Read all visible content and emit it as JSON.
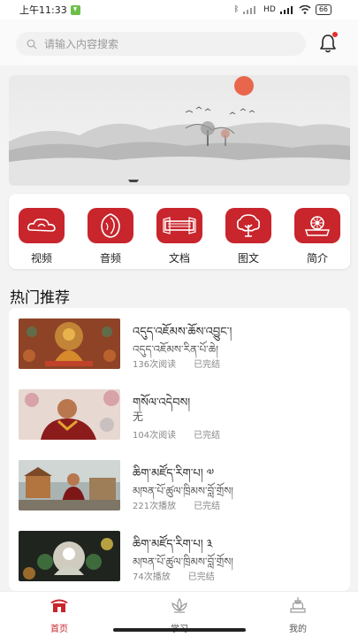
{
  "status_bar": {
    "time": "上午11:33",
    "network": "HD",
    "battery": "66"
  },
  "search": {
    "placeholder": "请输入内容搜索"
  },
  "banner": {
    "slide_index": 3,
    "slide_count": 5
  },
  "categories": [
    {
      "label": "视频",
      "icon": "cloud-icon"
    },
    {
      "label": "音频",
      "icon": "conch-shell-icon"
    },
    {
      "label": "文档",
      "icon": "scripture-icon"
    },
    {
      "label": "图文",
      "icon": "tree-icon"
    },
    {
      "label": "简介",
      "icon": "dharma-wheel-icon"
    }
  ],
  "section": {
    "title": "热门推荐"
  },
  "items": [
    {
      "title": "འདུད་འཇོམས་ཆོས་འབྱུང་།",
      "subtitle": "འདུད་འཇོམས་རིན་པོ་ཆེ།",
      "count": "136次阅读",
      "status": "已完结"
    },
    {
      "title": "གསོལ་འདེབས།",
      "subtitle": "无",
      "count": "104次阅读",
      "status": "已完结"
    },
    {
      "title": "ཆིག་མཛོད་རིག་པ། ༧",
      "subtitle": "མཁན་པོ་ཚུལ་ཁྲིམས་བློ་གྲོས།",
      "count": "221次播放",
      "status": "已完结"
    },
    {
      "title": "ཆིག་མཛོད་རིག་པ། ༣",
      "subtitle": "མཁན་པོ་ཚུལ་ཁྲིམས་བློ་གྲོས།",
      "count": "74次播放",
      "status": "已完结"
    }
  ],
  "tabs": [
    {
      "label": "首页",
      "active": true
    },
    {
      "label": "学习",
      "active": false
    },
    {
      "label": "我的",
      "active": false
    }
  ],
  "colors": {
    "accent": "#c8252c",
    "background": "#f3f3f3"
  }
}
